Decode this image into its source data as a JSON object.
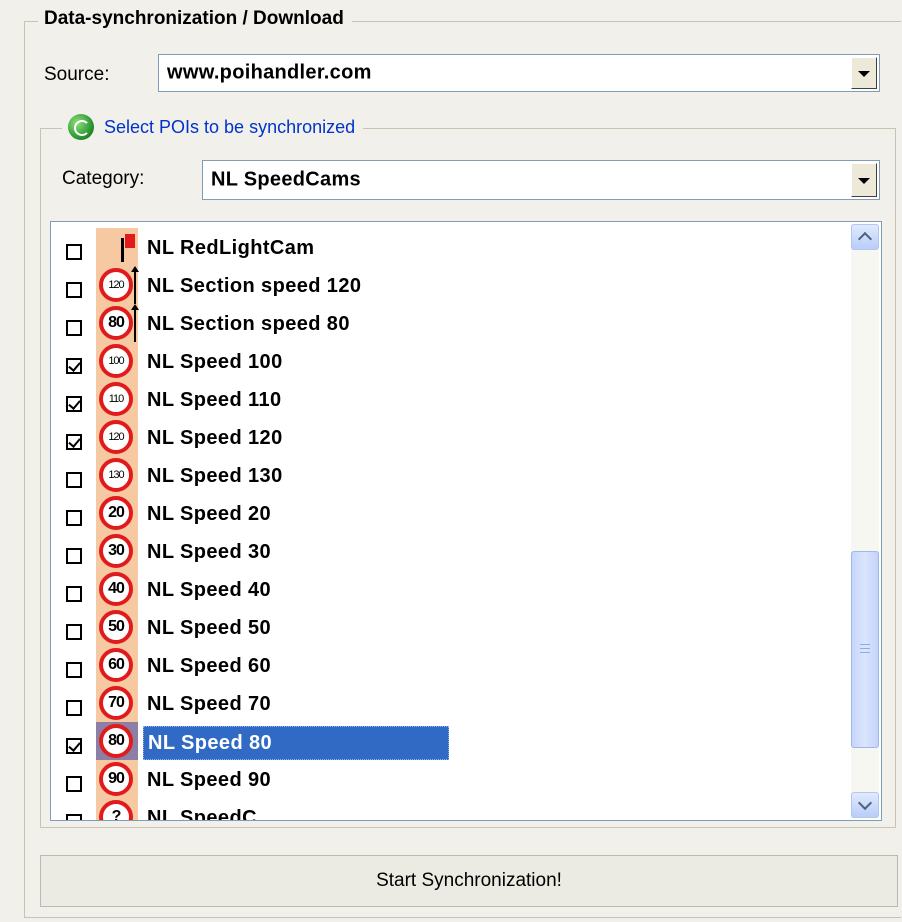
{
  "group": {
    "title": "Data-synchronization / Download",
    "source_label": "Source:",
    "source_value": "www.poihandler.com"
  },
  "select_group": {
    "title": "Select POIs to be synchronized",
    "icon": "sync-icon",
    "category_label": "Category:",
    "category_value": "NL SpeedCams"
  },
  "poi_list": [
    {
      "label": "NL RedLightCam",
      "checked": false,
      "icon": "red-light-camera-icon",
      "sign": ""
    },
    {
      "label": "NL Section speed 120",
      "checked": false,
      "icon": "section-speed-sign-icon",
      "sign": "120"
    },
    {
      "label": "NL Section speed 80",
      "checked": false,
      "icon": "section-speed-sign-icon",
      "sign": "80"
    },
    {
      "label": "NL Speed 100",
      "checked": true,
      "icon": "speed-limit-sign-icon",
      "sign": "100"
    },
    {
      "label": "NL Speed 110",
      "checked": true,
      "icon": "speed-limit-sign-icon",
      "sign": "110"
    },
    {
      "label": "NL Speed 120",
      "checked": true,
      "icon": "speed-limit-sign-icon",
      "sign": "120"
    },
    {
      "label": "NL Speed 130",
      "checked": false,
      "icon": "speed-limit-sign-icon",
      "sign": "130"
    },
    {
      "label": "NL Speed 20",
      "checked": false,
      "icon": "speed-limit-sign-icon",
      "sign": "20"
    },
    {
      "label": "NL Speed 30",
      "checked": false,
      "icon": "speed-limit-sign-icon",
      "sign": "30"
    },
    {
      "label": "NL Speed 40",
      "checked": false,
      "icon": "speed-limit-sign-icon",
      "sign": "40"
    },
    {
      "label": "NL Speed 50",
      "checked": false,
      "icon": "speed-limit-sign-icon",
      "sign": "50"
    },
    {
      "label": "NL Speed 60",
      "checked": false,
      "icon": "speed-limit-sign-icon",
      "sign": "60"
    },
    {
      "label": "NL Speed 70",
      "checked": false,
      "icon": "speed-limit-sign-icon",
      "sign": "70"
    },
    {
      "label": "NL Speed 80",
      "checked": true,
      "icon": "speed-limit-sign-icon",
      "sign": "80",
      "selected": true
    },
    {
      "label": "NL Speed 90",
      "checked": false,
      "icon": "speed-limit-sign-icon",
      "sign": "90"
    },
    {
      "label": "NL SpeedC",
      "checked": false,
      "icon": "speed-limit-sign-icon",
      "sign": "?"
    }
  ],
  "start_button": "Start Synchronization!",
  "colors": {
    "selection": "#316ac5",
    "sign_ring": "#e11b1b",
    "legend_link": "#0033cc"
  }
}
